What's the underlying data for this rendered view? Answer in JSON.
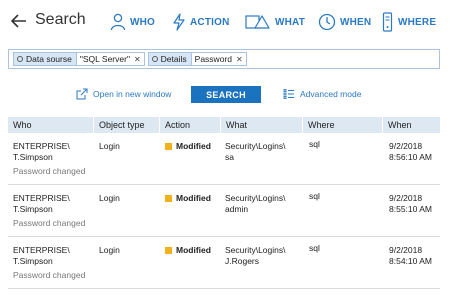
{
  "header": {
    "title": "Search",
    "filters": [
      {
        "label": "WHO",
        "icon": "user-icon"
      },
      {
        "label": "ACTION",
        "icon": "bolt-icon"
      },
      {
        "label": "WHAT",
        "icon": "shapes-icon"
      },
      {
        "label": "WHEN",
        "icon": "clock-icon"
      },
      {
        "label": "WHERE",
        "icon": "server-icon"
      }
    ]
  },
  "filter_bar": {
    "chips": [
      {
        "key": "Data sourse",
        "value": "\"SQL Server\""
      },
      {
        "key": "Details",
        "value": "Password"
      }
    ]
  },
  "actions": {
    "open_new_window": "Open in new window",
    "search": "SEARCH",
    "advanced_mode": "Advanced mode"
  },
  "table": {
    "columns": [
      "Who",
      "Object type",
      "Action",
      "What",
      "Where",
      "When"
    ],
    "rows": [
      {
        "who1": "ENTERPRISE\\",
        "who2": "T.Simpson",
        "object_type": "Login",
        "action": "Modified",
        "what1": "Security\\Logins\\",
        "what2": "sa",
        "where": "sql",
        "when1": "9/2/2018",
        "when2": "8:56:10 AM",
        "detail": "Password changed"
      },
      {
        "who1": "ENTERPRISE\\",
        "who2": "T.Simpson",
        "object_type": "Login",
        "action": "Modified",
        "what1": "Security\\Logins\\",
        "what2": "admin",
        "where": "sql",
        "when1": "9/2/2018",
        "when2": "8:55:10 AM",
        "detail": "Password changed"
      },
      {
        "who1": "ENTERPRISE\\",
        "who2": "T.Simpson",
        "object_type": "Login",
        "action": "Modified",
        "what1": "Security\\Logins\\",
        "what2": "J.Rogers",
        "where": "sql",
        "when1": "9/2/2018",
        "when2": "8:54:10 AM",
        "detail": "Password changed"
      }
    ]
  },
  "colors": {
    "accent": "#2b79c2",
    "button": "#1b72bf",
    "header_bg": "#dde8f3",
    "modified": "#f0b21a"
  }
}
